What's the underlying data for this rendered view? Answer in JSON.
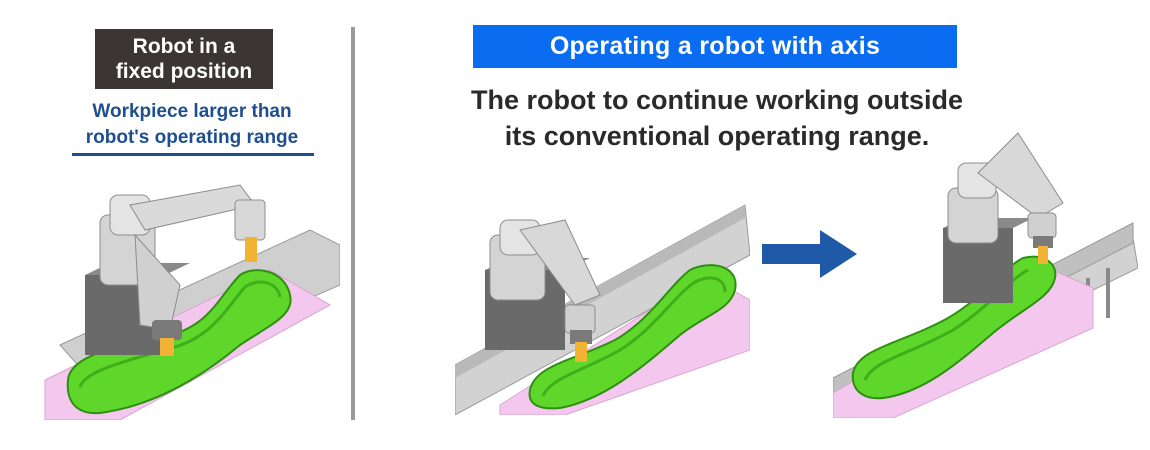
{
  "left_panel": {
    "tag_line1": "Robot in a",
    "tag_line2": "fixed position",
    "note_line1": "Workpiece larger than",
    "note_line2": "robot's operating range"
  },
  "right_panel": {
    "title": "Operating a robot with axis",
    "description_line1": "The robot to continue working outside",
    "description_line2": "its conventional operating range."
  },
  "colors": {
    "title_bg": "#0a6cf0",
    "tag_bg": "#3b3536",
    "note_text": "#1f4f8f",
    "arrow": "#1e5aa8",
    "workpiece_green": "#5ed62a",
    "fixture_pink": "#f4c8ee"
  },
  "icons": [
    "robot-arm-illustration",
    "right-arrow-icon"
  ]
}
